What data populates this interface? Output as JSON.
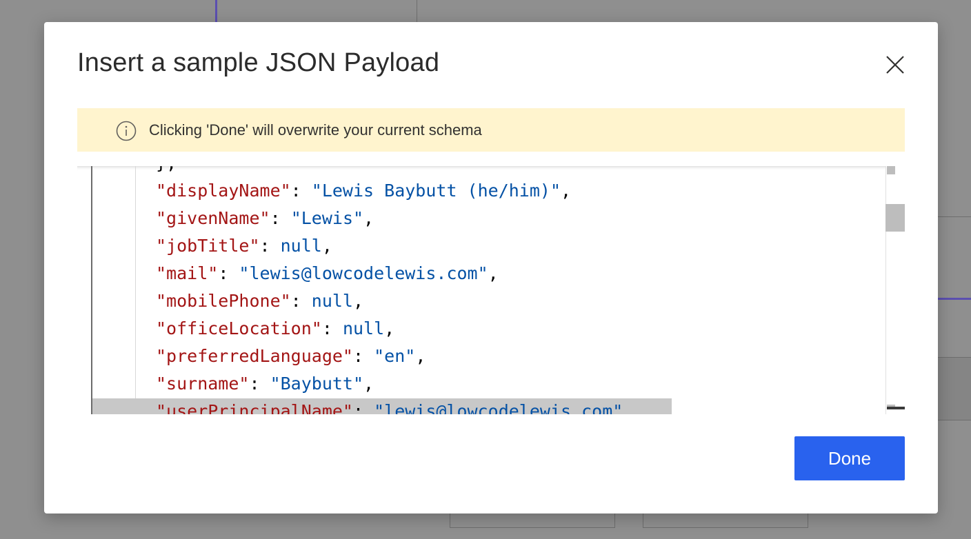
{
  "dialog": {
    "title": "Insert a sample JSON Payload",
    "close_icon": "close-icon",
    "warning": {
      "icon": "info-icon",
      "text": "Clicking 'Done' will overwrite your current schema"
    },
    "editor": {
      "lines": [
        {
          "text": "},",
          "parts": [
            {
              "cls": "p",
              "t": "},"
            }
          ]
        },
        {
          "parts": [
            {
              "cls": "k",
              "t": "\"displayName\""
            },
            {
              "cls": "p",
              "t": ": "
            },
            {
              "cls": "s",
              "t": "\"Lewis Baybutt (he/him)\""
            },
            {
              "cls": "p",
              "t": ","
            }
          ]
        },
        {
          "parts": [
            {
              "cls": "k",
              "t": "\"givenName\""
            },
            {
              "cls": "p",
              "t": ": "
            },
            {
              "cls": "s",
              "t": "\"Lewis\""
            },
            {
              "cls": "p",
              "t": ","
            }
          ]
        },
        {
          "parts": [
            {
              "cls": "k",
              "t": "\"jobTitle\""
            },
            {
              "cls": "p",
              "t": ": "
            },
            {
              "cls": "n",
              "t": "null"
            },
            {
              "cls": "p",
              "t": ","
            }
          ]
        },
        {
          "parts": [
            {
              "cls": "k",
              "t": "\"mail\""
            },
            {
              "cls": "p",
              "t": ": "
            },
            {
              "cls": "s",
              "t": "\"lewis@lowcodelewis.com\""
            },
            {
              "cls": "p",
              "t": ","
            }
          ]
        },
        {
          "parts": [
            {
              "cls": "k",
              "t": "\"mobilePhone\""
            },
            {
              "cls": "p",
              "t": ": "
            },
            {
              "cls": "n",
              "t": "null"
            },
            {
              "cls": "p",
              "t": ","
            }
          ]
        },
        {
          "parts": [
            {
              "cls": "k",
              "t": "\"officeLocation\""
            },
            {
              "cls": "p",
              "t": ": "
            },
            {
              "cls": "n",
              "t": "null"
            },
            {
              "cls": "p",
              "t": ","
            }
          ]
        },
        {
          "parts": [
            {
              "cls": "k",
              "t": "\"preferredLanguage\""
            },
            {
              "cls": "p",
              "t": ": "
            },
            {
              "cls": "s",
              "t": "\"en\""
            },
            {
              "cls": "p",
              "t": ","
            }
          ]
        },
        {
          "parts": [
            {
              "cls": "k",
              "t": "\"surname\""
            },
            {
              "cls": "p",
              "t": ": "
            },
            {
              "cls": "s",
              "t": "\"Baybutt\""
            },
            {
              "cls": "p",
              "t": ","
            }
          ]
        },
        {
          "parts": [
            {
              "cls": "k",
              "t": "\"userPrincipalName\""
            },
            {
              "cls": "p",
              "t": ": "
            },
            {
              "cls": "s",
              "t": "\"lewis@lowcodelewis.com\""
            },
            {
              "cls": "p",
              "t": ","
            }
          ]
        }
      ]
    },
    "done_label": "Done"
  },
  "colors": {
    "accent": "#2962ee",
    "warning_bg": "#fff4ce",
    "json_key": "#a31515",
    "json_value": "#0451a5"
  }
}
